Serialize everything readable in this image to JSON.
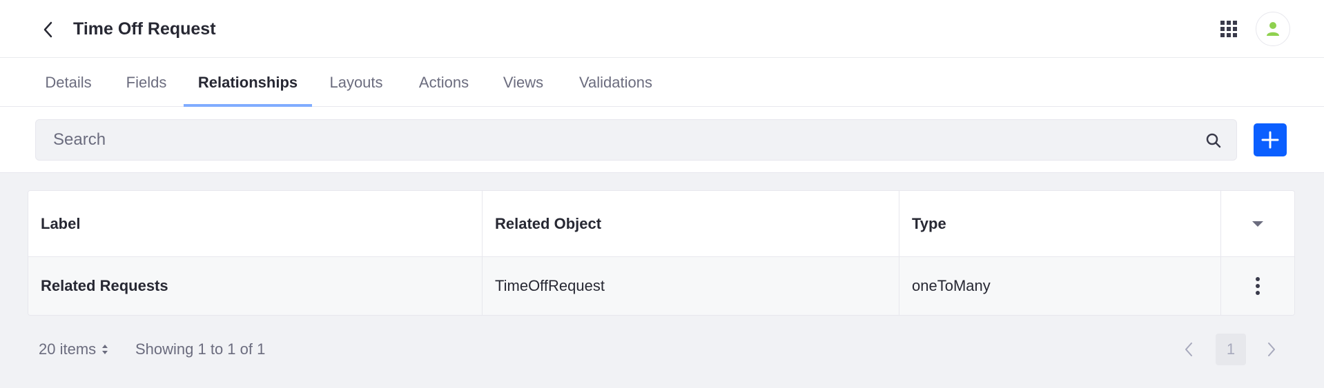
{
  "header": {
    "title": "Time Off Request"
  },
  "tabs": [
    {
      "label": "Details",
      "active": false
    },
    {
      "label": "Fields",
      "active": false
    },
    {
      "label": "Relationships",
      "active": true
    },
    {
      "label": "Layouts",
      "active": false
    },
    {
      "label": "Actions",
      "active": false
    },
    {
      "label": "Views",
      "active": false
    },
    {
      "label": "Validations",
      "active": false
    }
  ],
  "search": {
    "placeholder": "Search",
    "value": ""
  },
  "table": {
    "columns": [
      "Label",
      "Related Object",
      "Type"
    ],
    "rows": [
      {
        "label": "Related Requests",
        "related_object": "TimeOffRequest",
        "type": "oneToMany"
      }
    ]
  },
  "pagination": {
    "items_per_page": "20 items",
    "showing": "Showing 1 to 1 of 1",
    "current_page": "1"
  },
  "colors": {
    "primary": "#0b5fff",
    "tab_indicator": "#80acff",
    "avatar_icon": "#8fd14f",
    "page_background": "#f1f2f5"
  },
  "icons": {
    "back": "chevron-left-icon",
    "apps": "grid-icon",
    "user": "user-icon",
    "search": "search-icon",
    "add": "plus-icon",
    "columns": "caret-down-icon",
    "row_actions": "ellipsis-vertical-icon",
    "sort": "caret-double-icon",
    "prev": "chevron-left-icon",
    "next": "chevron-right-icon"
  }
}
